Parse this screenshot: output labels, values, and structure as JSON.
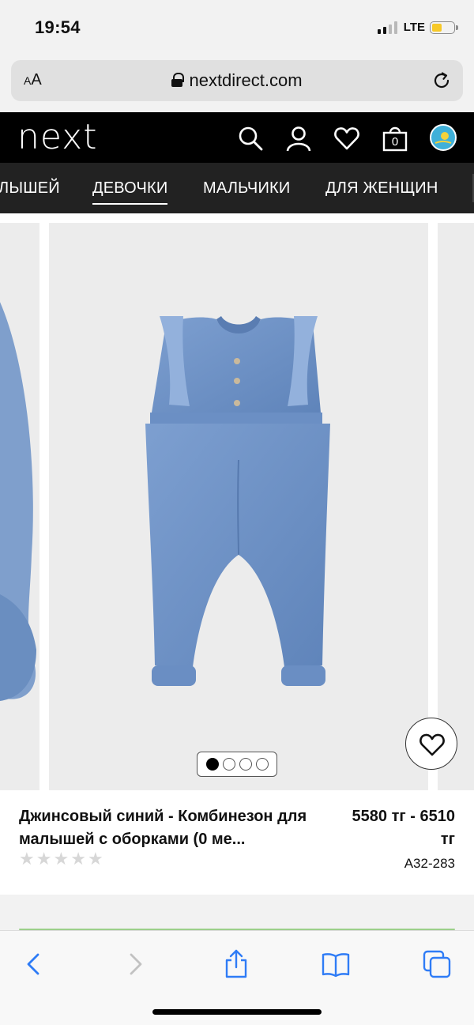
{
  "status_bar": {
    "time": "19:54",
    "network": "LTE",
    "icons": [
      "signal-icon",
      "battery-icon"
    ]
  },
  "browser": {
    "text_size_label_small": "A",
    "text_size_label_large": "A",
    "url": "nextdirect.com",
    "icons": [
      "lock-icon",
      "reload-icon"
    ]
  },
  "header": {
    "logo": "next",
    "icons": [
      "search-icon",
      "account-icon",
      "wishlist-icon",
      "bag-icon",
      "country-flag-icon"
    ],
    "bag_count": "0"
  },
  "categories": {
    "items": [
      {
        "label": "ЛЫШЕЙ",
        "active": false
      },
      {
        "label": "ДЕВОЧКИ",
        "active": true
      },
      {
        "label": "МАЛЬЧИКИ",
        "active": false
      },
      {
        "label": "ДЛЯ ЖЕНЩИН",
        "active": false
      }
    ]
  },
  "carousel": {
    "slide_count": 4,
    "active_slide": 1,
    "image_description": "denim romper",
    "accent_color": "#6d8fc2"
  },
  "product": {
    "title": "Джинсовый синий - Комбинезон для малышей с оборками (0 ме...",
    "price_line1": "5580 тг - 6510",
    "price_line2": "тг",
    "rating": 0,
    "rating_max": 5,
    "sku": "A32-283"
  },
  "toolbar": {
    "icons": [
      "back-icon",
      "forward-icon",
      "share-icon",
      "bookmarks-icon",
      "tabs-icon"
    ]
  }
}
